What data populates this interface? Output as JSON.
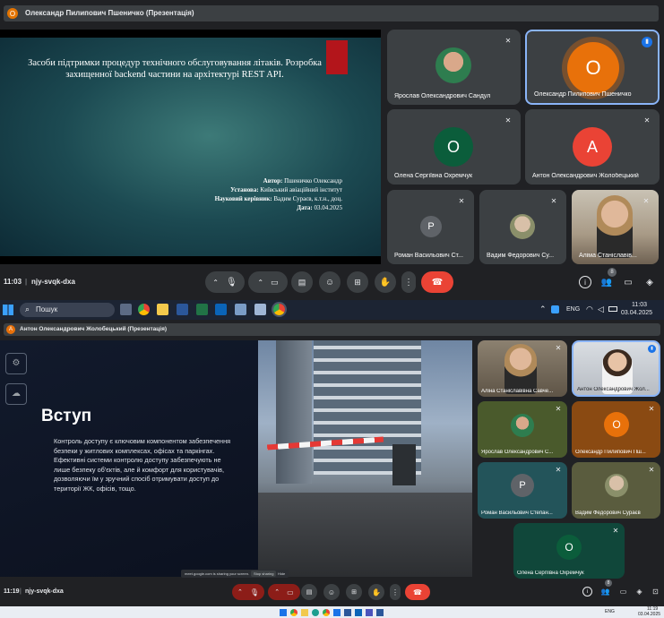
{
  "top": {
    "presenter_initial": "О",
    "presenter_title": "Олександр Пилипович Пшеничко (Презентація)",
    "slide": {
      "title": "Засоби підтримки процедур технічного обслуговування літаків. Розробка захищенної backend частини на архітектурі REST API.",
      "author_label": "Автор:",
      "author": "Пшеничко Олександр",
      "inst_label": "Установа:",
      "inst": "Київський авіаційний інститут",
      "sup_label": "Науковий керівник:",
      "sup": "Вадим Сураєв, к.т.н., доц.",
      "date_label": "Дата:",
      "date": "03.04.2025"
    },
    "tiles": [
      {
        "name": "Ярослав Олександрович Сандул"
      },
      {
        "name": "Олександр Пилипович Пшеничко",
        "initial": "О"
      },
      {
        "name": "Олена Сергіївна Охремчук",
        "initial": "О"
      },
      {
        "name": "Антон Олександрович Жолобецький",
        "initial": "А"
      },
      {
        "name": "Роман Васильович Ст...",
        "initial": "Р"
      },
      {
        "name": "Вадим Федорович Су..."
      },
      {
        "name": "Аліма Станіславів..."
      }
    ],
    "time": "11:03",
    "code": "njy-svqk-dxa",
    "participants_badge": "8"
  },
  "taskbar": {
    "search": "Пошук",
    "lang": "ENG",
    "time": "11:03",
    "date": "03.04.2025"
  },
  "bottom": {
    "presenter_initial": "А",
    "presenter_title": "Антон Олександрович Жолобецький (Презентація)",
    "slide": {
      "heading": "Вступ",
      "body": "Контроль доступу є ключовим компонентом забезпечення безпеки у житлових комплексах, офісах та паркінгах. Ефективні системи контролю доступу забезпечують не лише безпеку об'єктів, але й комфорт для користувачів, дозволяючи їм у зручний спосіб отримувати доступ до території ЖК, офісів, тощо."
    },
    "share_bar": {
      "text": "meet.google.com is sharing your screen.",
      "stop": "Stop sharing",
      "hide": "Hide"
    },
    "tiles": [
      {
        "name": "Аліна Станіславівна Савче..."
      },
      {
        "name": "Антон Олександрович Жол..."
      },
      {
        "name": "Ярослав Олександрович С..."
      },
      {
        "name": "Олександр Пилипович Пш...",
        "initial": "О"
      },
      {
        "name": "Роман Васильович Степан...",
        "initial": "Р"
      },
      {
        "name": "Вадим Федорович Сураєв"
      },
      {
        "name": "Олена Сергіївна Охремчук",
        "initial": "О"
      }
    ],
    "time": "11:19",
    "code": "njy-svqk-dxa",
    "participants_badge": "8",
    "mini_time": "11:19",
    "mini_date": "03.04.2025",
    "mini_lang": "ENG"
  }
}
